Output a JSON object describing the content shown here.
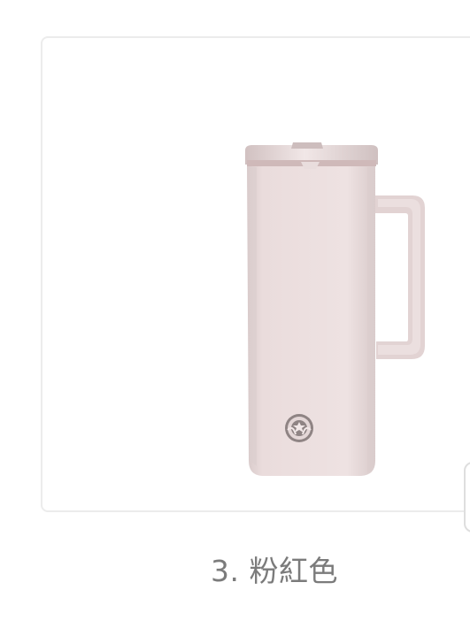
{
  "product": {
    "name": "3. 粉紅色",
    "image": {
      "icon_name": "starbucks-pink-mug-image",
      "mug_color": "#eadcdc",
      "handle_color": "#e6d7d7",
      "lid_color": "#d6c8c8",
      "logo_color": "#8f8484"
    },
    "cart_button": {
      "icon_name": "cart-icon"
    }
  }
}
